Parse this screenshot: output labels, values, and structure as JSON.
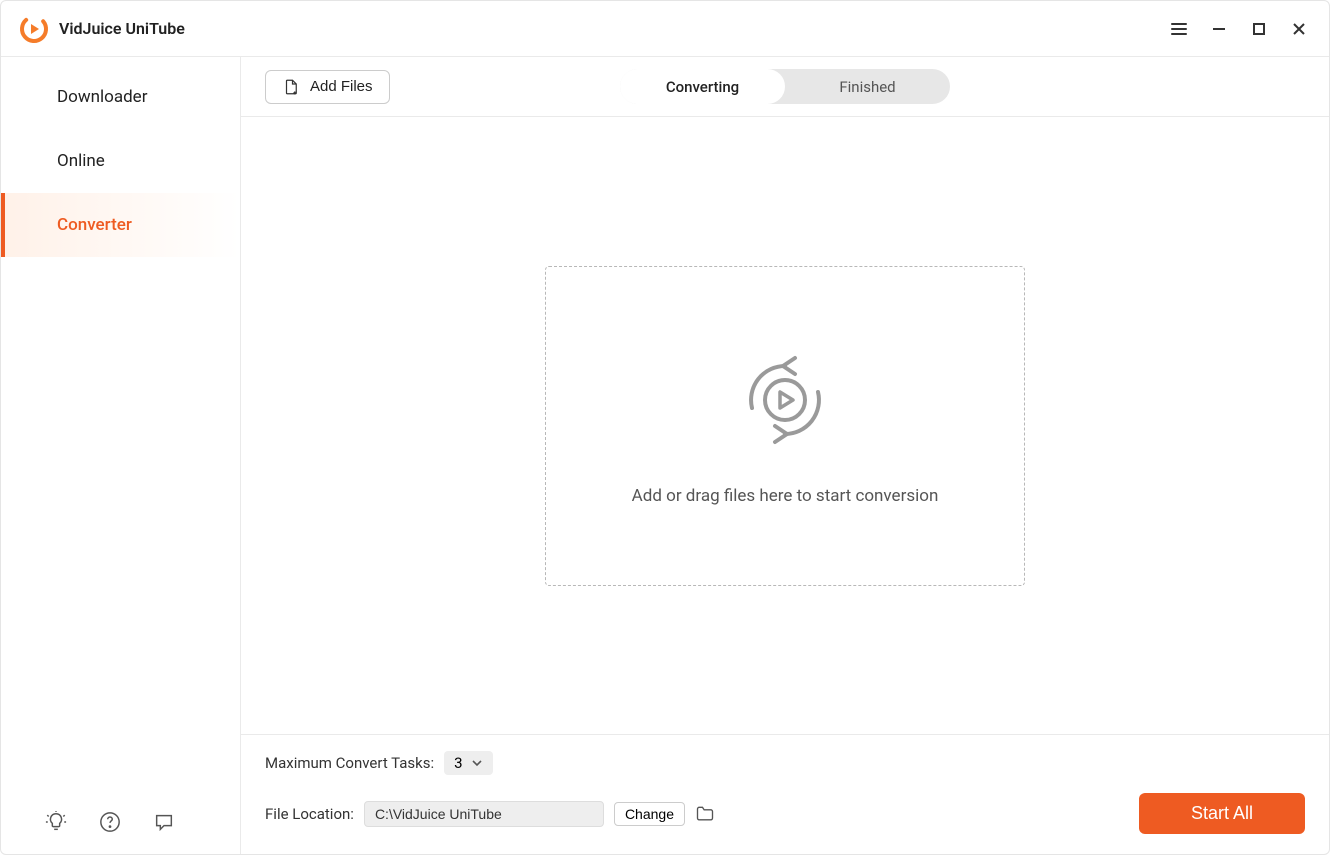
{
  "app": {
    "title": "VidJuice UniTube"
  },
  "sidebar": {
    "items": [
      {
        "label": "Downloader"
      },
      {
        "label": "Online"
      },
      {
        "label": "Converter"
      }
    ]
  },
  "toolbar": {
    "add_files_label": "Add Files",
    "tabs": [
      {
        "label": "Converting"
      },
      {
        "label": "Finished"
      }
    ]
  },
  "dropzone": {
    "message": "Add or drag files here to start conversion"
  },
  "bottom": {
    "max_tasks_label": "Maximum Convert Tasks:",
    "max_tasks_value": "3",
    "file_location_label": "File Location:",
    "file_location_value": "C:\\VidJuice UniTube",
    "change_label": "Change",
    "start_all_label": "Start All"
  }
}
